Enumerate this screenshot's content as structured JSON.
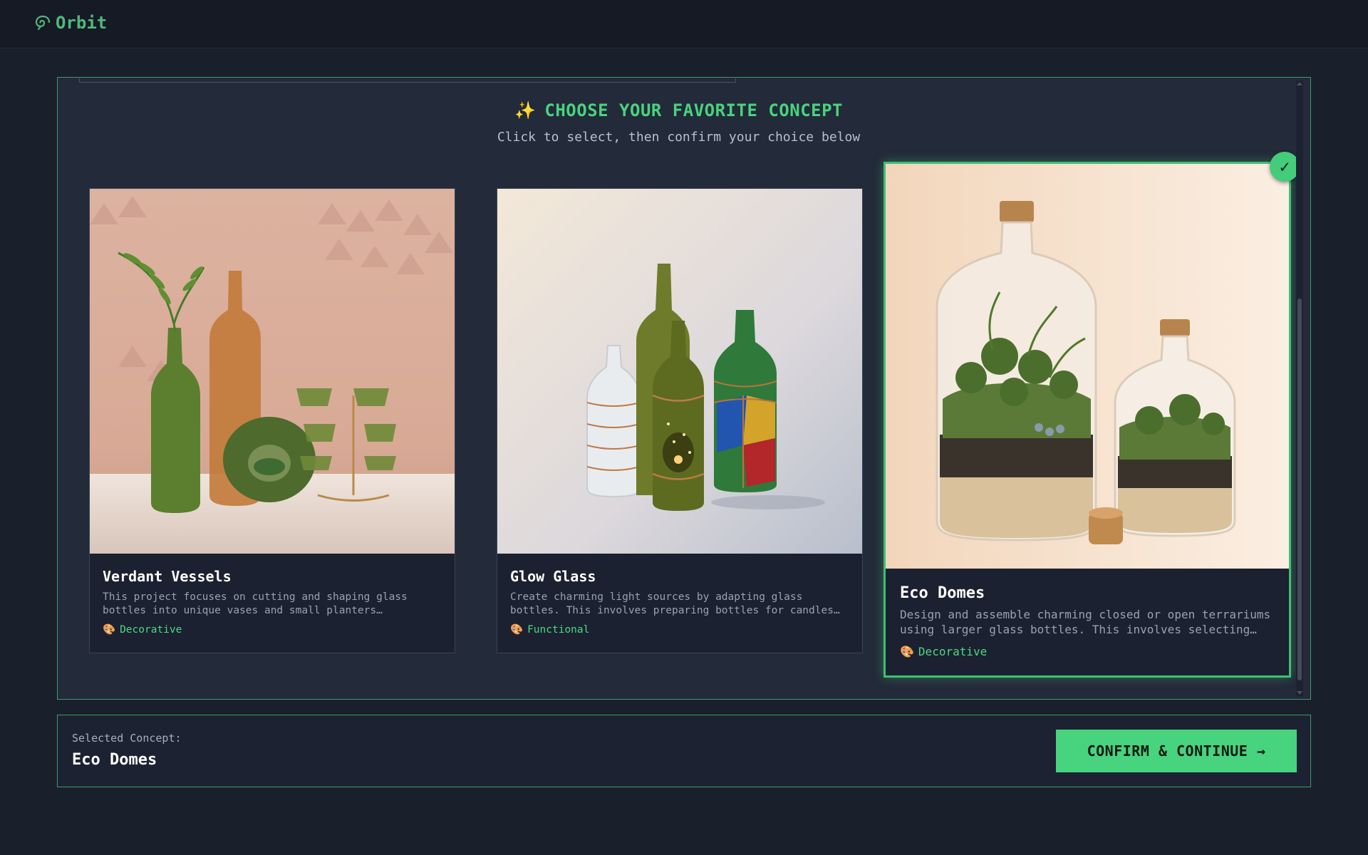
{
  "app": {
    "name": "Orbit",
    "logo_icon": "leaf-swirl-icon",
    "accent": "#48d37e"
  },
  "chooser": {
    "heading_icon": "✨",
    "heading": "CHOOSE YOUR FAVORITE CONCEPT",
    "subheading": "Click to select, then confirm your choice below"
  },
  "concepts": [
    {
      "title": "Verdant Vessels",
      "description": "This project focuses on cutting and shaping glass bottles into unique vases and small planters…",
      "tag_icon": "🎨",
      "tag": "Decorative",
      "selected": false
    },
    {
      "title": "Glow Glass",
      "description": "Create charming light sources by adapting glass bottles. This involves preparing bottles for candles o…",
      "tag_icon": "🎨",
      "tag": "Functional",
      "selected": false
    },
    {
      "title": "Eco Domes",
      "description": "Design and assemble charming closed or open terrariums using larger glass bottles. This involves selecting…",
      "tag_icon": "🎨",
      "tag": "Decorative",
      "selected": true
    }
  ],
  "selection": {
    "label": "Selected Concept:",
    "value": "Eco Domes",
    "check_icon": "✓"
  },
  "actions": {
    "confirm_label": "CONFIRM & CONTINUE →"
  }
}
